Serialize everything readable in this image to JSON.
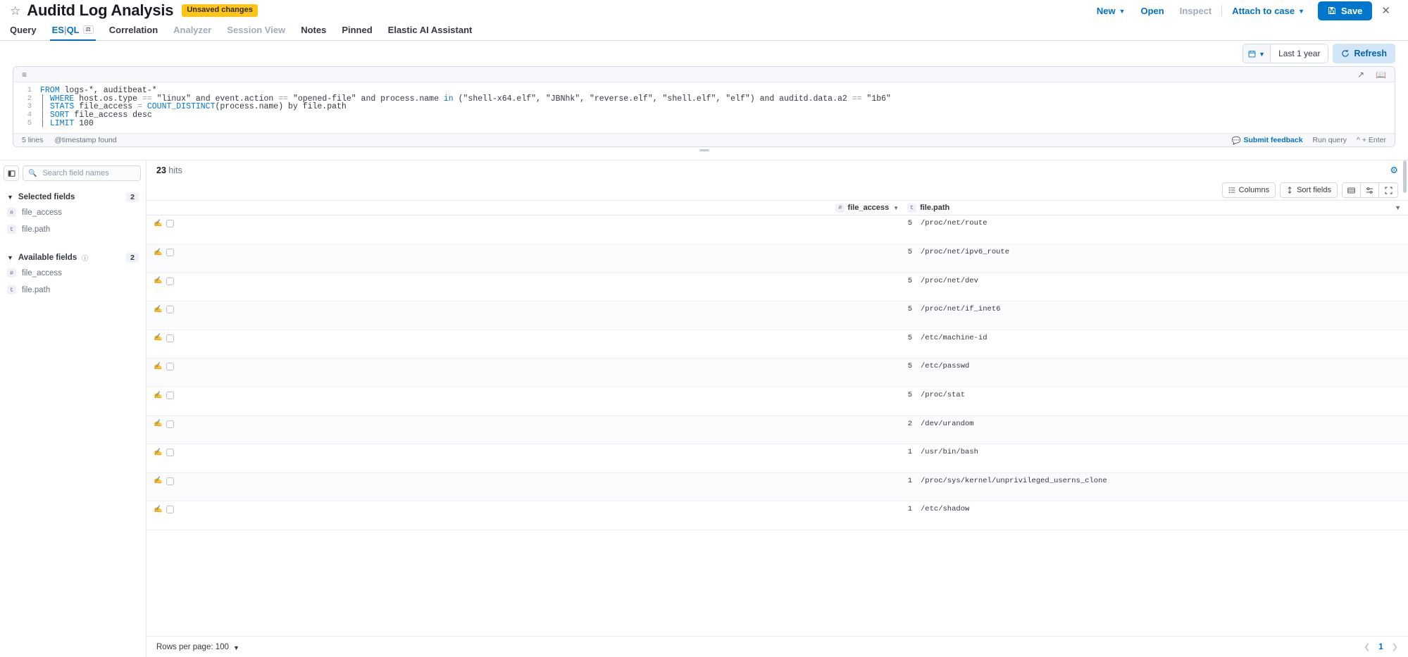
{
  "header": {
    "star_icon": "star-icon",
    "title": "Auditd Log Analysis",
    "unsaved_badge": "Unsaved changes",
    "new_label": "New",
    "open_label": "Open",
    "inspect_label": "Inspect",
    "attach_label": "Attach to case",
    "save_label": "Save",
    "close_label": "✕",
    "accent_color": "#0071c2",
    "save_bg": "#0077cc",
    "badge_bg": "#fec514"
  },
  "tabs": [
    {
      "label": "Query",
      "state": "normal"
    },
    {
      "label": "ES|QL",
      "state": "active"
    },
    {
      "label": "Correlation",
      "state": "normal"
    },
    {
      "label": "Analyzer",
      "state": "disabled"
    },
    {
      "label": "Session View",
      "state": "disabled"
    },
    {
      "label": "Notes",
      "state": "normal"
    },
    {
      "label": "Pinned",
      "state": "normal"
    },
    {
      "label": "Elastic AI Assistant",
      "state": "normal"
    }
  ],
  "query_toolbar": {
    "date_range": "Last 1 year",
    "refresh_label": "Refresh",
    "calendar_icon": "calendar-icon",
    "refresh_icon": "refresh-icon"
  },
  "editor": {
    "lines": [
      {
        "n": "1",
        "text": "FROM logs-*, auditbeat-*"
      },
      {
        "n": "2",
        "text": "| WHERE host.os.type == \"linux\" and event.action == \"opened-file\" and process.name in (\"shell-x64.elf\", \"JBNhk\", \"reverse.elf\", \"shell.elf\", \"elf\") and auditd.data.a2 == \"1b6\""
      },
      {
        "n": "3",
        "text": "| STATS file_access = COUNT_DISTINCT(process.name) by file.path"
      },
      {
        "n": "4",
        "text": "| SORT file_access desc"
      },
      {
        "n": "5",
        "text": "| LIMIT 100"
      }
    ],
    "footer_lines": "5 lines",
    "footer_timestamp": "@timestamp found",
    "submit_feedback": "Submit feedback",
    "run_query": "Run query",
    "run_shortcut": "^ + Enter"
  },
  "sidebar": {
    "search_placeholder": "Search field names",
    "search_value": "",
    "filter_count": "0",
    "sections": [
      {
        "title": "Selected fields",
        "count": "2",
        "has_info": false,
        "fields": [
          {
            "type": "#",
            "name": "file_access"
          },
          {
            "type": "t",
            "name": "file.path"
          }
        ]
      },
      {
        "title": "Available fields",
        "count": "2",
        "has_info": true,
        "fields": [
          {
            "type": "#",
            "name": "file_access"
          },
          {
            "type": "t",
            "name": "file.path"
          }
        ]
      }
    ]
  },
  "results": {
    "hits_count": "23",
    "hits_label": "hits",
    "columns_label": "Columns",
    "sort_fields_label": "Sort fields",
    "col_access": "file_access",
    "col_access_type": "#",
    "col_path": "file.path",
    "col_path_type": "t",
    "rows_per_page_label": "Rows per page: 100",
    "page_number": "1"
  },
  "chart_data": {
    "type": "table",
    "title": "file_access by file.path",
    "columns": [
      "file_access",
      "file.path"
    ],
    "rows": [
      {
        "file_access": "5",
        "file_path": "/proc/net/route"
      },
      {
        "file_access": "5",
        "file_path": "/proc/net/ipv6_route"
      },
      {
        "file_access": "5",
        "file_path": "/proc/net/dev"
      },
      {
        "file_access": "5",
        "file_path": "/proc/net/if_inet6"
      },
      {
        "file_access": "5",
        "file_path": "/etc/machine-id"
      },
      {
        "file_access": "5",
        "file_path": "/etc/passwd"
      },
      {
        "file_access": "5",
        "file_path": "/proc/stat"
      },
      {
        "file_access": "2",
        "file_path": "/dev/urandom"
      },
      {
        "file_access": "1",
        "file_path": "/usr/bin/bash"
      },
      {
        "file_access": "1",
        "file_path": "/proc/sys/kernel/unprivileged_userns_clone"
      },
      {
        "file_access": "1",
        "file_path": "/etc/shadow"
      }
    ]
  }
}
